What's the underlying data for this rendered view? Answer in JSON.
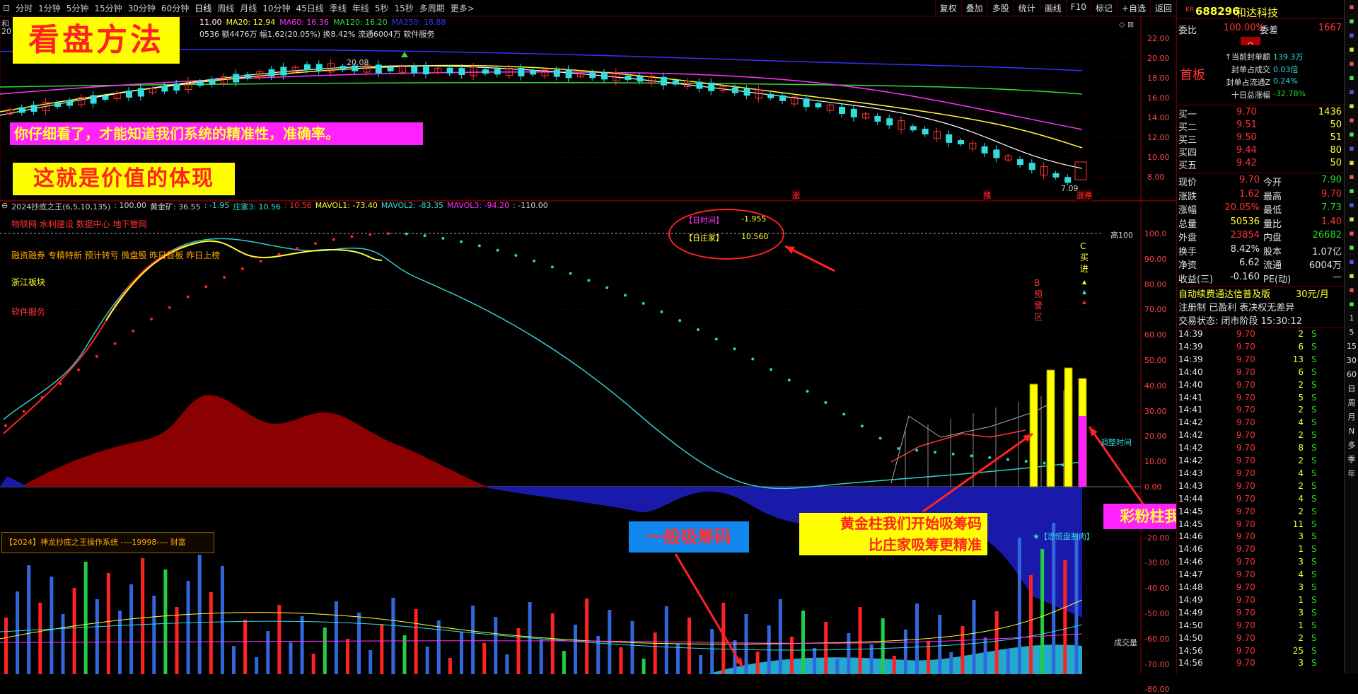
{
  "toolbar": {
    "periods": [
      "分时",
      "1分钟",
      "5分钟",
      "15分钟",
      "30分钟",
      "60分钟",
      "日线",
      "周线",
      "月线",
      "10分钟",
      "45日线",
      "季线",
      "年线",
      "5秒",
      "15秒",
      "多周期",
      "更多>"
    ],
    "active": "日线",
    "right_buttons": [
      "复权",
      "叠加",
      "多股",
      "统计",
      "画线",
      "F10",
      "标记",
      "+自选",
      "返回"
    ]
  },
  "price_panel": {
    "ma_legend": [
      {
        "label": "11.00",
        "color": "#ffffff"
      },
      {
        "label": "MA20: 12.94",
        "color": "#ffff33"
      },
      {
        "label": "MA60: 16.36",
        "color": "#ff33ff"
      },
      {
        "label": "MA120: 16.20",
        "color": "#33dd33"
      },
      {
        "label": "MA250: 18.88",
        "color": "#3333ff"
      }
    ],
    "info_line2": "0536 额4476万 幅1.62(20.05%) 换8.42% 流通6004万 软件服务",
    "left_code_char": "和",
    "left_code_char2": "20",
    "high_label": "20.08",
    "low_label": "7.09",
    "y_ticks": [
      "22.00",
      "20.00",
      "18.00",
      "16.00",
      "14.00",
      "12.00",
      "10.00",
      "8.00"
    ],
    "tags": [
      "涨",
      "预",
      "涨停"
    ]
  },
  "indicator_panel": {
    "title": "2024抄底之王(6,5,10,135)",
    "legend_items": [
      {
        "text": ": 100.00",
        "color": "#cccccc"
      },
      {
        "text": "黄金矿: 36.55",
        "color": "#cccccc"
      },
      {
        "text": ": -1.95",
        "color": "#33dddd"
      },
      {
        "text": "庄家3: 10.56",
        "color": "#33dddd"
      },
      {
        "text": ": 10.56",
        "color": "#ff3333"
      },
      {
        "text": "MAVOL1: -73.40",
        "color": "#ffff33"
      },
      {
        "text": "MAVOL2: -83.35",
        "color": "#33dddd"
      },
      {
        "text": "MAVOL3: -94.20",
        "color": "#ff33ff"
      },
      {
        "text": ": -110.00",
        "color": "#cccccc"
      }
    ],
    "side_labels": [
      {
        "text": "物联网 水利建设 数据中心 地下管网",
        "color": "#ff3333"
      },
      {
        "text": "融资融券 专精特新 预计转亏 微盘股 昨日首板 昨日上榜",
        "color": "#ffaa00"
      },
      {
        "text": "浙江板块",
        "color": "#ffff33"
      },
      {
        "text": "软件服务",
        "color": "#ff3333"
      }
    ],
    "annot_time_label": "【日时间】",
    "annot_time_value": "-1.955",
    "annot_zhuang_label": "【日庄家】",
    "annot_zhuang_value": "10.560",
    "high_line_label": "高100",
    "adjust_label": "调整时间",
    "volume_label": "成交量",
    "fear_label": "★【恐慌盘割肉】",
    "vertical_B": "B预警区",
    "vertical_C": "C买进",
    "y_ticks": [
      "100.0",
      "90.00",
      "80.00",
      "70.00",
      "60.00",
      "50.00",
      "40.00",
      "30.00",
      "20.00",
      "10.00",
      "0.00",
      "-10.00",
      "-20.00",
      "-30.00",
      "-40.00",
      "-50.00",
      "-60.00",
      "-70.00",
      "-80.00"
    ],
    "system_box": "【2024】神龙抄底之王操作系统    ----19998---- 财富"
  },
  "banners": {
    "title": "看盘方法",
    "line1": "你仔细看了，才能知道我们系统的精准性，准确率。",
    "line2": "这就是价值的体现",
    "general": "一般吸筹码",
    "gold1": "黄金柱我们开始吸筹码",
    "gold2": "比庄家吸筹更精准",
    "pink": "彩粉柱我们必须跟进"
  },
  "quote": {
    "kr": "KR",
    "code": "688296",
    "name": "和达科技",
    "weibi_label": "委比",
    "weibi_value": "100.00%",
    "weicha_label": "委差",
    "weicha_value": "1667",
    "status_big": "首板",
    "seal_stats": [
      {
        "label": "↑当前封单额",
        "value": "139.3万"
      },
      {
        "label": "封单占成交",
        "value": "0.03倍"
      },
      {
        "label": "封单占流通Z",
        "value": "0.24%"
      },
      {
        "label": "十日总涨幅",
        "value": "-32.78%"
      }
    ],
    "bids": [
      {
        "label": "买一",
        "price": "9.70",
        "vol": "1436"
      },
      {
        "label": "买二",
        "price": "9.51",
        "vol": "50"
      },
      {
        "label": "买三",
        "price": "9.50",
        "vol": "51"
      },
      {
        "label": "买四",
        "price": "9.44",
        "vol": "80"
      },
      {
        "label": "买五",
        "price": "9.42",
        "vol": "50"
      }
    ],
    "stats": [
      {
        "l1": "现价",
        "v1": "9.70",
        "c1": "#ff3333",
        "l2": "今开",
        "v2": "7.90",
        "c2": "#22dd22"
      },
      {
        "l1": "涨跌",
        "v1": "1.62",
        "c1": "#ff3333",
        "l2": "最高",
        "v2": "9.70",
        "c2": "#ff3333"
      },
      {
        "l1": "涨幅",
        "v1": "20.05%",
        "c1": "#ff3333",
        "l2": "最低",
        "v2": "7.73",
        "c2": "#22dd22"
      },
      {
        "l1": "总量",
        "v1": "50536",
        "c1": "#ffff33",
        "l2": "量比",
        "v2": "1.40",
        "c2": "#ff3333"
      },
      {
        "l1": "外盘",
        "v1": "23854",
        "c1": "#ff3333",
        "l2": "内盘",
        "v2": "26682",
        "c2": "#22dd22"
      },
      {
        "l1": "换手",
        "v1": "8.42%",
        "c1": "#e0e0e0",
        "l2": "股本",
        "v2": "1.07亿",
        "c2": "#e0e0e0"
      },
      {
        "l1": "净资",
        "v1": "6.62",
        "c1": "#e0e0e0",
        "l2": "流通",
        "v2": "6004万",
        "c2": "#e0e0e0"
      },
      {
        "l1": "收益(三)",
        "v1": "-0.160",
        "c1": "#e0e0e0",
        "l2": "PE(动)",
        "v2": "—",
        "c2": "#e0e0e0"
      }
    ],
    "promo": "自动续费通达信普及版",
    "promo_price": "30元/月",
    "reg_line": "注册制 已盈利 表决权无差异",
    "trade_status": "交易状态: 闭市阶段 15:30:12",
    "ticks": [
      [
        "14:39",
        "9.70",
        "2",
        "S"
      ],
      [
        "14:39",
        "9.70",
        "6",
        "S"
      ],
      [
        "14:39",
        "9.70",
        "13",
        "S"
      ],
      [
        "14:40",
        "9.70",
        "6",
        "S"
      ],
      [
        "14:40",
        "9.70",
        "2",
        "S"
      ],
      [
        "14:41",
        "9.70",
        "5",
        "S"
      ],
      [
        "14:41",
        "9.70",
        "2",
        "S"
      ],
      [
        "14:42",
        "9.70",
        "4",
        "S"
      ],
      [
        "14:42",
        "9.70",
        "2",
        "S"
      ],
      [
        "14:42",
        "9.70",
        "8",
        "S"
      ],
      [
        "14:42",
        "9.70",
        "2",
        "S"
      ],
      [
        "14:43",
        "9.70",
        "4",
        "S"
      ],
      [
        "14:43",
        "9.70",
        "2",
        "S"
      ],
      [
        "14:44",
        "9.70",
        "4",
        "S"
      ],
      [
        "14:45",
        "9.70",
        "2",
        "S"
      ],
      [
        "14:45",
        "9.70",
        "11",
        "S"
      ],
      [
        "14:46",
        "9.70",
        "3",
        "S"
      ],
      [
        "14:46",
        "9.70",
        "1",
        "S"
      ],
      [
        "14:46",
        "9.70",
        "3",
        "S"
      ],
      [
        "14:47",
        "9.70",
        "4",
        "S"
      ],
      [
        "14:48",
        "9.70",
        "3",
        "S"
      ],
      [
        "14:49",
        "9.70",
        "1",
        "S"
      ],
      [
        "14:49",
        "9.70",
        "3",
        "S"
      ],
      [
        "14:50",
        "9.70",
        "1",
        "S"
      ],
      [
        "14:50",
        "9.70",
        "2",
        "S"
      ],
      [
        "14:56",
        "9.70",
        "25",
        "S"
      ],
      [
        "14:56",
        "9.70",
        "3",
        "S"
      ]
    ]
  },
  "side_strip": [
    "1",
    "5",
    "15",
    "30",
    "60",
    "日",
    "周",
    "月",
    "N",
    "多",
    "季",
    "年"
  ]
}
